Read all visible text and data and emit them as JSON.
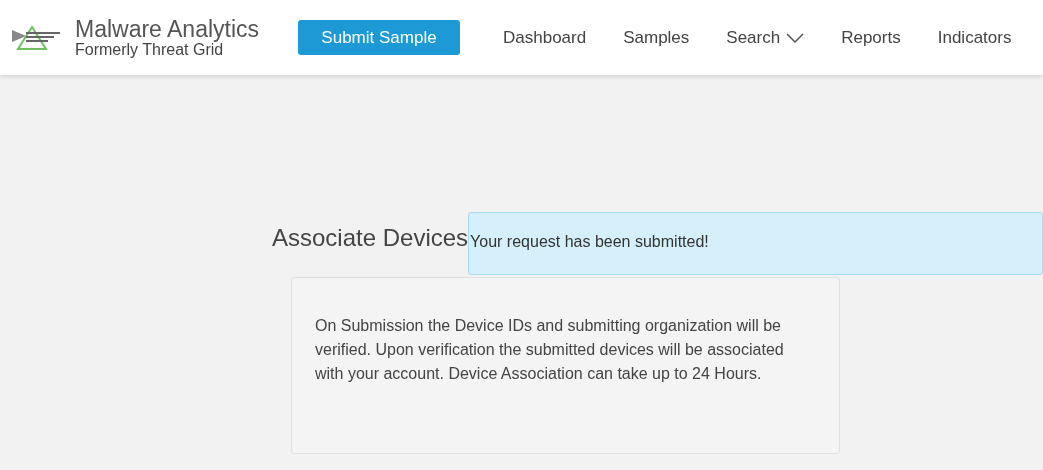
{
  "header": {
    "brand": {
      "title": "Malware Analytics",
      "subtitle": "Formerly Threat Grid"
    },
    "submit_button": "Submit Sample",
    "nav": [
      {
        "label": "Dashboard",
        "kind": "link"
      },
      {
        "label": "Samples",
        "kind": "link"
      },
      {
        "label": "Search",
        "kind": "dropdown"
      },
      {
        "label": "Reports",
        "kind": "link"
      },
      {
        "label": "Indicators",
        "kind": "link"
      }
    ]
  },
  "page": {
    "title": "Associate Devices",
    "alert": "Your request has been submitted!",
    "info": "On Submission the Device IDs and submitting organization will be verified. Upon verification the submitted devices will be associated with your account. Device Association can take up to 24 Hours."
  }
}
